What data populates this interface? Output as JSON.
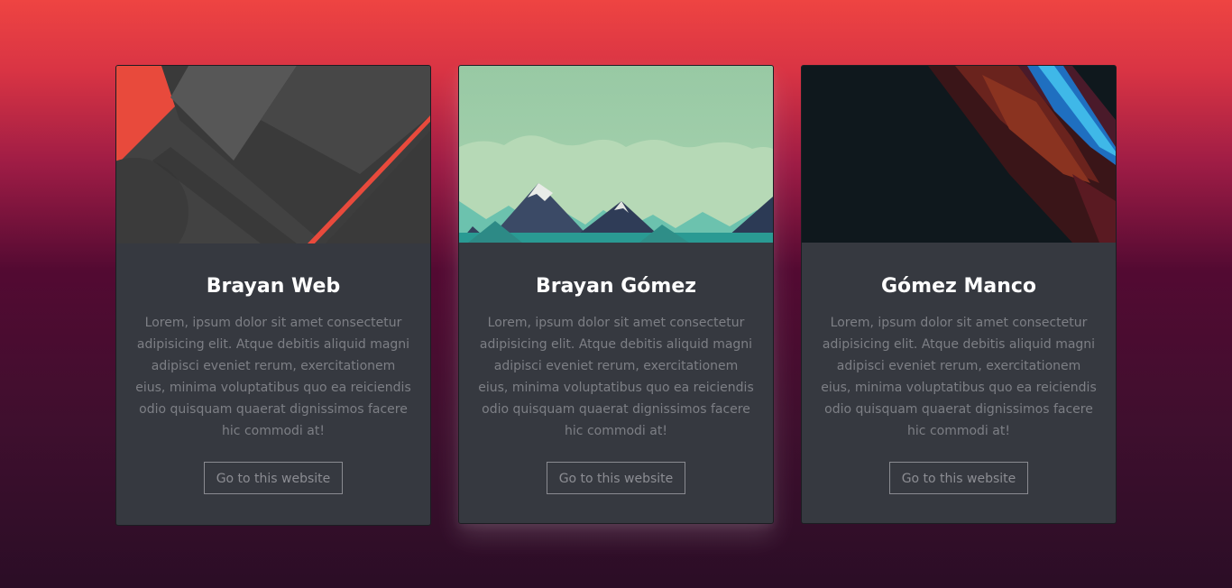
{
  "colors": {
    "card_bg": "#363940",
    "title": "#ffffff",
    "text": "#7d7f85",
    "button_border": "#8a8b91",
    "accent_red": "#e84a3c"
  },
  "cards": [
    {
      "image": "material-geometric-image",
      "title": "Brayan Web",
      "text": "Lorem, ipsum dolor sit amet consectetur adipisicing elit. Atque debitis aliquid magni adipisci eveniet rerum, exercitationem eius, minima voluptatibus quo ea reiciendis odio quisquam quaerat dignissimos facere hic commodi at!",
      "button": "Go to this website"
    },
    {
      "image": "mountain-landscape-image",
      "title": "Brayan Gómez",
      "text": "Lorem, ipsum dolor sit amet consectetur adipisicing elit. Atque debitis aliquid magni adipisci eveniet rerum, exercitationem eius, minima voluptatibus quo ea reiciendis odio quisquam quaerat dignissimos facere hic commodi at!",
      "button": "Go to this website"
    },
    {
      "image": "dark-abstract-image",
      "title": "Gómez Manco",
      "text": "Lorem, ipsum dolor sit amet consectetur adipisicing elit. Atque debitis aliquid magni adipisci eveniet rerum, exercitationem eius, minima voluptatibus quo ea reiciendis odio quisquam quaerat dignissimos facere hic commodi at!",
      "button": "Go to this website"
    }
  ]
}
